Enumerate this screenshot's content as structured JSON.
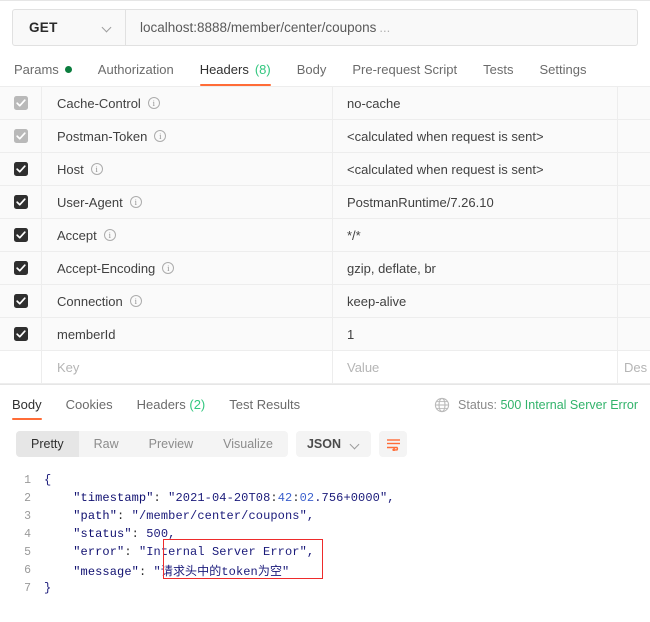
{
  "request": {
    "method": "GET",
    "url": "localhost:8888/member/center/coupons",
    "url_ellipsis": "...",
    "tabs": [
      {
        "label": "Params",
        "active": false,
        "dot": true
      },
      {
        "label": "Authorization",
        "active": false,
        "dot": false
      },
      {
        "label": "Headers",
        "count": "(8)",
        "active": true,
        "dot": false
      },
      {
        "label": "Body",
        "active": false,
        "dot": false
      },
      {
        "label": "Pre-request Script",
        "active": false,
        "dot": false
      },
      {
        "label": "Tests",
        "active": false,
        "dot": false
      },
      {
        "label": "Settings",
        "active": false,
        "dot": false
      }
    ]
  },
  "headers_table": {
    "placeholder_key": "Key",
    "placeholder_value": "Value",
    "placeholder_desc": "Des",
    "rows": [
      {
        "checked": true,
        "style": "grey",
        "key": "Cache-Control",
        "info": true,
        "value": "no-cache"
      },
      {
        "checked": true,
        "style": "grey",
        "key": "Postman-Token",
        "info": true,
        "value": "<calculated when request is sent>"
      },
      {
        "checked": true,
        "style": "dark",
        "key": "Host",
        "info": true,
        "value": "<calculated when request is sent>"
      },
      {
        "checked": true,
        "style": "dark",
        "key": "User-Agent",
        "info": true,
        "value": "PostmanRuntime/7.26.10"
      },
      {
        "checked": true,
        "style": "dark",
        "key": "Accept",
        "info": true,
        "value": "*/*"
      },
      {
        "checked": true,
        "style": "dark",
        "key": "Accept-Encoding",
        "info": true,
        "value": "gzip, deflate, br"
      },
      {
        "checked": true,
        "style": "dark",
        "key": "Connection",
        "info": true,
        "value": "keep-alive"
      },
      {
        "checked": true,
        "style": "dark",
        "key": "memberId",
        "info": false,
        "value": "1"
      }
    ]
  },
  "response": {
    "tabs": [
      {
        "label": "Body",
        "active": true
      },
      {
        "label": "Cookies",
        "active": false
      },
      {
        "label": "Headers",
        "count": "(2)",
        "active": false
      },
      {
        "label": "Test Results",
        "active": false
      }
    ],
    "status_label": "Status:",
    "status_value": "500 Internal Server Error",
    "status_color": "#32b36b",
    "format_buttons": [
      {
        "label": "Pretty",
        "active": true
      },
      {
        "label": "Raw",
        "active": false
      },
      {
        "label": "Preview",
        "active": false
      },
      {
        "label": "Visualize",
        "active": false
      }
    ],
    "language": "JSON",
    "wrap_icon": "word-wrap-icon"
  },
  "code": {
    "line_numbers": [
      "1",
      "2",
      "3",
      "4",
      "5",
      "6",
      "7"
    ],
    "json": {
      "timestamp": "2021-04-20T08:42:02.756+0000",
      "path": "/member/center/coupons",
      "status": "500",
      "error": "Internal Server Error",
      "message": "请求头中的token为空"
    },
    "keys": {
      "timestamp": "\"timestamp\"",
      "path": "\"path\"",
      "status": "\"status\"",
      "error": "\"error\"",
      "message": "\"message\""
    },
    "lines": [
      "{",
      "    \"timestamp\": \"2021-04-20T08:42:02.756+0000\",",
      "    \"path\": \"/member/center/coupons\",",
      "    \"status\": 500,",
      "    \"error\": \"Internal Server Error\",",
      "    \"message\": \"请求头中的token为空\"",
      "}"
    ]
  },
  "annotation": {
    "color": "#ee2b2b",
    "shape": "rectangle"
  }
}
